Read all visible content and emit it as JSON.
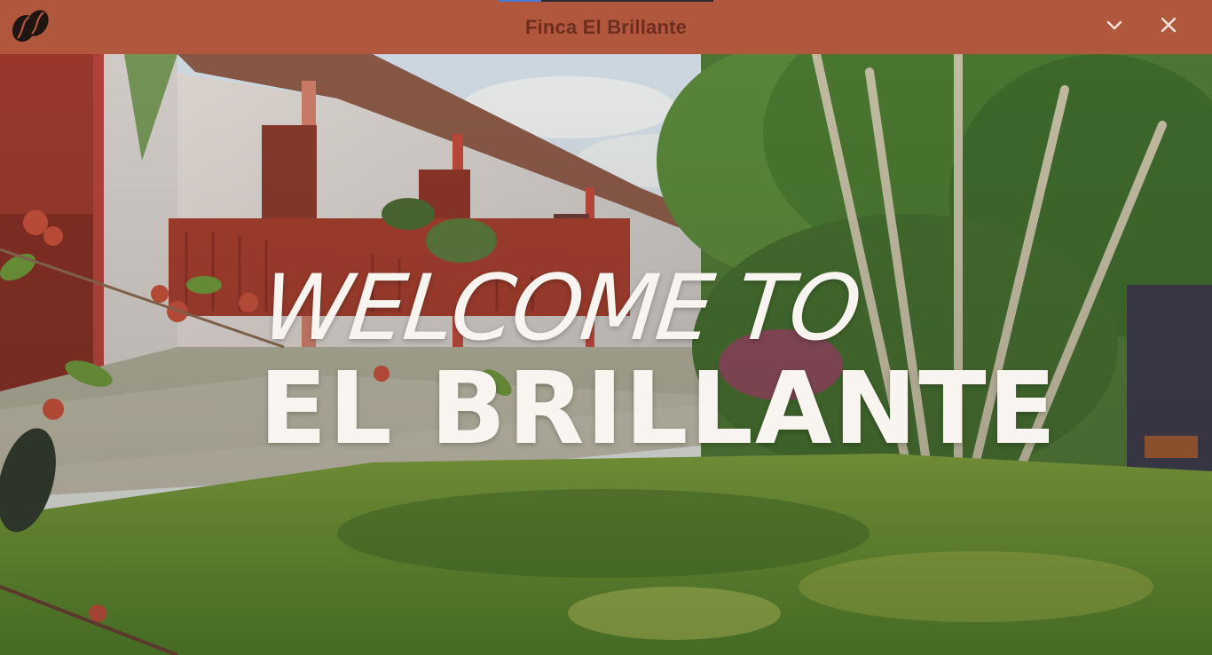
{
  "header": {
    "title": "Finca El Brillante",
    "logo_icon": "coffee-beans-icon",
    "collapse_icon": "chevron-down-icon",
    "close_icon": "close-icon",
    "accent_color": "#b0573d",
    "title_color": "#6e2e1e",
    "control_color": "#f4e6df"
  },
  "hero": {
    "line1": "WELCOME TO",
    "line2": "EL BRILLANTE",
    "text_color": "#f8f4f0"
  }
}
